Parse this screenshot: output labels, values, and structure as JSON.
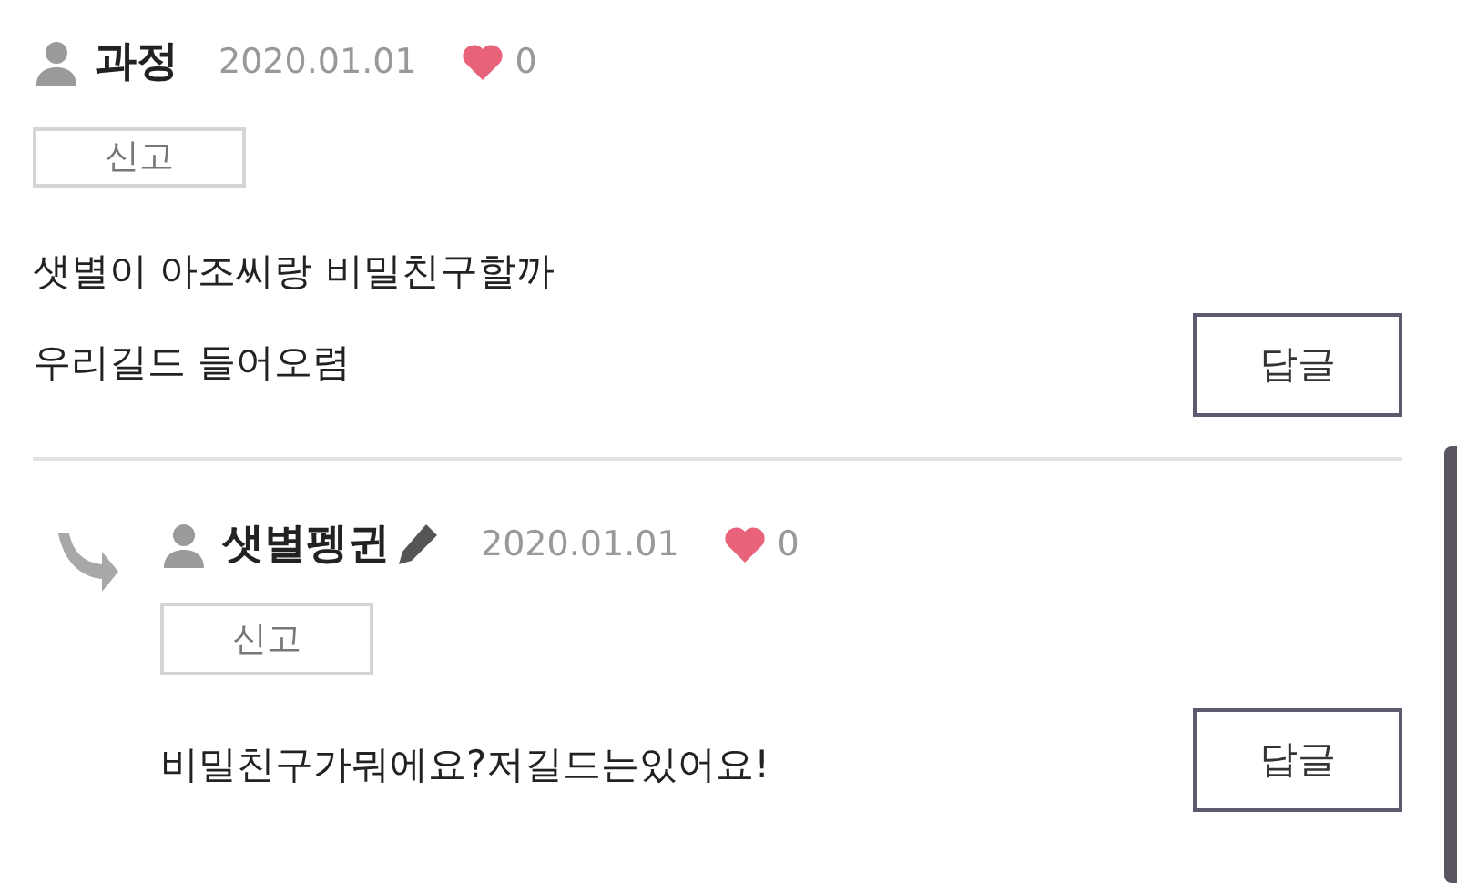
{
  "comments": [
    {
      "kind": "comment",
      "author": "과정",
      "edited": false,
      "date": "2020.01.01",
      "likes": "0",
      "report": "신고",
      "lines": [
        "샛별이 아조씨랑 비밀친구할까",
        "우리길드 들어오렴"
      ],
      "reply_button": "답글"
    },
    {
      "kind": "reply",
      "author": "샛별펭귄",
      "edited": true,
      "date": "2020.01.01",
      "likes": "0",
      "report": "신고",
      "lines": [
        "비밀친구가뭐에요?저길드는있어요!"
      ],
      "reply_button": "답글"
    }
  ]
}
